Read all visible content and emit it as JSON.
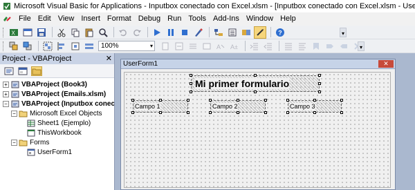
{
  "window": {
    "title": "Microsoft Visual Basic for Applications - Inputbox conectado con Excel.xlsm - [Inputbox conectado con Excel.xlsm - UserForm1 (UserForm)]"
  },
  "menubar": {
    "items": [
      "File",
      "Edit",
      "View",
      "Insert",
      "Format",
      "Debug",
      "Run",
      "Tools",
      "Add-Ins",
      "Window",
      "Help"
    ]
  },
  "toolbar2": {
    "zoom_value": "100%"
  },
  "project_pane": {
    "title": "Project - VBAProject",
    "tree": [
      {
        "label": "VBAProject (Book3)",
        "bold": true
      },
      {
        "label": "VBAProject (Emails.xlsm)",
        "bold": true
      },
      {
        "label": "VBAProject (Inputbox conectado",
        "bold": true
      },
      {
        "label": "Microsoft Excel Objects",
        "bold": false
      },
      {
        "label": "Sheet1 (Ejemplo)",
        "bold": false
      },
      {
        "label": "ThisWorkbook",
        "bold": false
      },
      {
        "label": "Forms",
        "bold": false
      },
      {
        "label": "UserForm1",
        "bold": false
      }
    ]
  },
  "userform": {
    "caption": "UserForm1",
    "close_label": "✕",
    "title_label": "Mi primer formulario",
    "fields": [
      "Campo 1",
      "Campo 2",
      "Campo 3"
    ]
  },
  "colors": {
    "workarea": "#aab8cf",
    "pane_header": "#c9d3e6",
    "close_button": "#c74a3a"
  }
}
